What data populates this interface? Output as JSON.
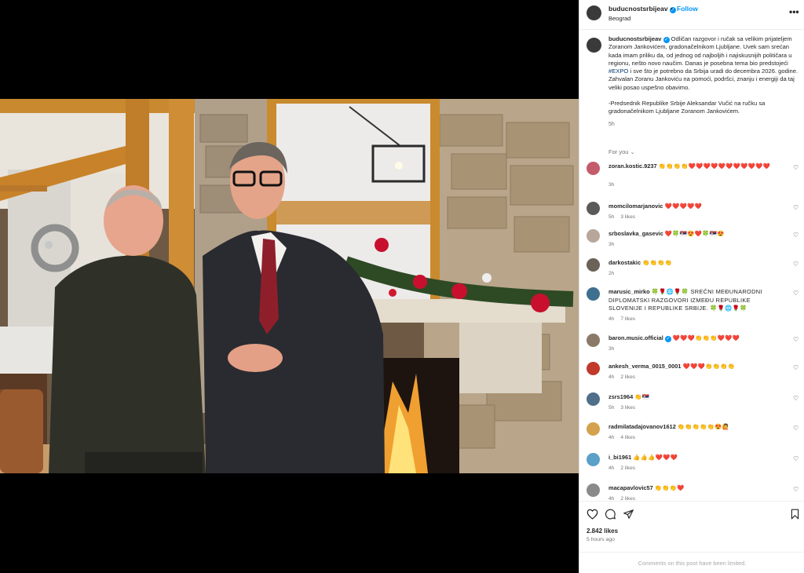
{
  "post": {
    "username": "buducnostsrbijeav",
    "follow_label": "Follow",
    "location": "Beograd",
    "more_label": "•••"
  },
  "caption": {
    "username": "buducnostsrbijeav",
    "text_before_tag": "Odličan razgovor i ručak sa velikim prijateljem Zoranom Jankovićem, gradonačelnikom Ljubljane. Uvek sam srećan kada imam priliku da, od jednog od najboljih i najiskusnijih političara u regionu, nešto novo naučim. Danas je posebna tema bio predstojeći",
    "hashtag": "#EXPO",
    "text_after_tag": "i sve što je potrebno da Srbija uradi do decembra 2026. godine. Zahvalan Zoranu Jankoviću na pomoći, podršci, znanju i energiji da taj veliki posao uspešno obavimo.",
    "signature": "-Predsednik Republike Srbije Aleksandar Vučić na ručku sa gradonačelnikom Ljubljane Zoranom Jankovićem.",
    "time": "5h"
  },
  "for_you_label": "For you",
  "comments": [
    {
      "username": "zoran.kostic.9237",
      "text": "👏👏👏👏❤️❤️❤️❤️❤️❤️❤️❤️❤️❤️❤️",
      "time": "3h",
      "likes": "",
      "avatar_color": "#c45b6a"
    },
    {
      "username": "momcilomarjanovic",
      "text": "❤️❤️❤️❤️❤️",
      "time": "5h",
      "likes": "3 likes",
      "avatar_color": "#5a5a5a"
    },
    {
      "username": "srboslavka_gasevic",
      "text": "❤️🍀🇷🇸😍❤️🍀🇷🇸😍",
      "time": "3h",
      "likes": "",
      "avatar_color": "#b7a79b"
    },
    {
      "username": "darkostakic",
      "text": "👏👏👏👏",
      "time": "2h",
      "likes": "",
      "avatar_color": "#6b6258"
    },
    {
      "username": "marusic_mirko",
      "text": "🍀🌹🌐🌹🍀 SREĆNI MEĐUNARODNI DIPLOMATSKI RAZGOVORI IZMEĐU REPUBLIKE SLOVENIJE I REPUBLIKE SRBIJE. 🍀🌹🌐🌹🍀",
      "time": "4h",
      "likes": "7 likes",
      "avatar_color": "#3f6f8f"
    },
    {
      "username": "baron.music.official",
      "text": "❤️❤️❤️👏👏👏❤️❤️❤️",
      "time": "3h",
      "likes": "",
      "avatar_color": "#8a7a6a",
      "verified": "✓"
    },
    {
      "username": "ankesh_verma_0015_0001",
      "text": "❤️❤️❤️👏👏👏👏",
      "time": "4h",
      "likes": "2 likes",
      "avatar_color": "#c0392b"
    },
    {
      "username": "zsrs1964",
      "text": "👏🇷🇸",
      "time": "5h",
      "likes": "3 likes",
      "avatar_color": "#4f6f8a"
    },
    {
      "username": "radmilatadajovanov1612",
      "text": "👏👏👏👏👏😍🙋",
      "time": "4h",
      "likes": "4 likes",
      "avatar_color": "#d4a24c"
    },
    {
      "username": "i_bi1961",
      "text": "👍👍👍❤️❤️❤️",
      "time": "4h",
      "likes": "2 likes",
      "avatar_color": "#5aa0c8"
    },
    {
      "username": "macapavlovic57",
      "text": "👏👏👏❤️",
      "time": "4h",
      "likes": "2 likes",
      "avatar_color": "#8a8a8a"
    }
  ],
  "actions": {
    "likes": "2.842 likes",
    "ago": "5 hours ago",
    "limited": "Comments on this post have been limited."
  },
  "icons": {
    "heart": "heart-icon",
    "comment": "comment-icon",
    "share": "share-icon",
    "save": "bookmark-icon"
  },
  "colors": {
    "accent": "#0095f6",
    "hashtag": "#00376b",
    "heart_red": "#ed4956"
  }
}
